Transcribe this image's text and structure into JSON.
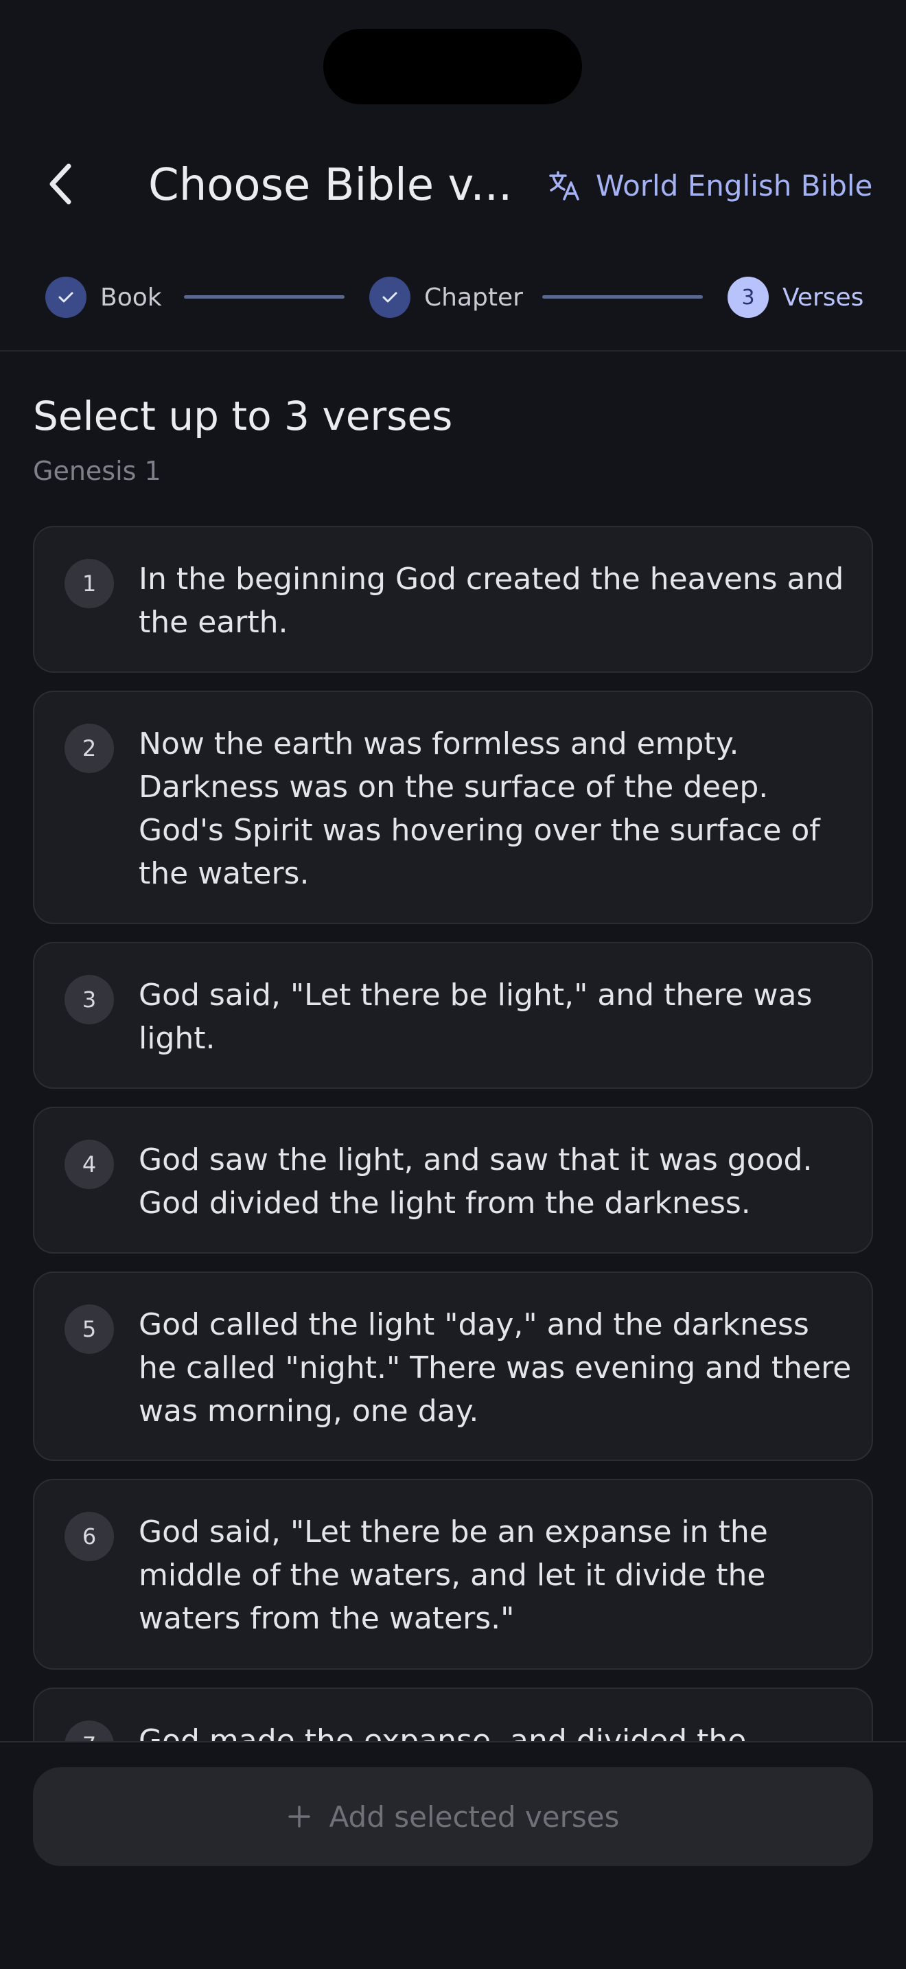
{
  "header": {
    "title": "Choose Bible v...",
    "version_label": "World English Bible",
    "back_icon": "chevron-left-icon",
    "translate_icon": "translate-icon"
  },
  "stepper": {
    "steps": [
      {
        "label": "Book",
        "state": "done"
      },
      {
        "label": "Chapter",
        "state": "done"
      },
      {
        "label": "Verses",
        "state": "active",
        "number": "3"
      }
    ]
  },
  "content": {
    "title": "Select up to 3 verses",
    "subtitle": "Genesis 1",
    "verses": [
      {
        "num": "1",
        "text": "In the beginning God created the heavens and the earth."
      },
      {
        "num": "2",
        "text": "Now the earth was formless and empty. Darkness was on the surface of the deep. God's Spirit was hovering over the surface of the waters."
      },
      {
        "num": "3",
        "text": "God said, \"Let there be light,\" and there was light."
      },
      {
        "num": "4",
        "text": "God saw the light, and saw that it was good. God divided the light from the darkness."
      },
      {
        "num": "5",
        "text": "God called the light \"day,\" and the darkness he called \"night.\" There was evening and there was morning, one day."
      },
      {
        "num": "6",
        "text": "God said, \"Let there be an expanse in the middle of the waters, and let it divide the waters from the waters.\""
      },
      {
        "num": "7",
        "text": "God made the expanse, and divided the waters"
      }
    ]
  },
  "footer": {
    "add_label": "Add selected verses",
    "add_icon": "plus-icon"
  },
  "colors": {
    "background": "#131419",
    "card": "#1c1d22",
    "accent": "#b8c3fb",
    "step_done": "#3b4b8a"
  }
}
